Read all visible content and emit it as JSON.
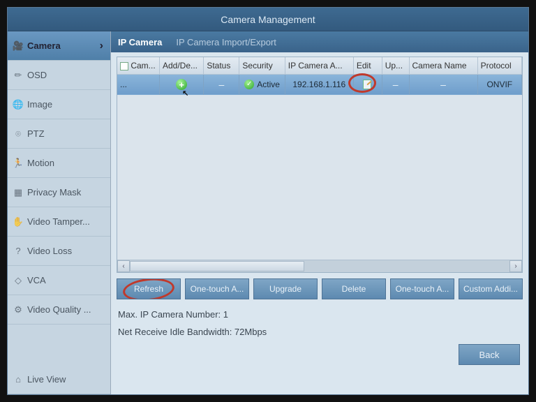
{
  "title": "Camera Management",
  "sidebar": {
    "items": [
      {
        "label": "Camera"
      },
      {
        "label": "OSD"
      },
      {
        "label": "Image"
      },
      {
        "label": "PTZ"
      },
      {
        "label": "Motion"
      },
      {
        "label": "Privacy Mask"
      },
      {
        "label": "Video Tamper..."
      },
      {
        "label": "Video Loss"
      },
      {
        "label": "VCA"
      },
      {
        "label": "Video Quality ..."
      }
    ],
    "footer": {
      "label": "Live View"
    }
  },
  "tabs": [
    {
      "label": "IP Camera"
    },
    {
      "label": "IP Camera Import/Export"
    }
  ],
  "table": {
    "columns": [
      "Cam...",
      "Add/De...",
      "Status",
      "Security",
      "IP Camera A...",
      "Edit",
      "Up...",
      "Camera Name",
      "Protocol"
    ],
    "rows": [
      {
        "cam": "...",
        "add": "+",
        "status": "–",
        "security": "Active",
        "ip": "192.168.1.116",
        "edit": "edit",
        "up": "–",
        "name": "–",
        "protocol": "ONVIF"
      }
    ]
  },
  "buttons": {
    "refresh": "Refresh",
    "onetouch1": "One-touch A...",
    "upgrade": "Upgrade",
    "delete": "Delete",
    "onetouch2": "One-touch A...",
    "custom": "Custom Addi..."
  },
  "info": {
    "max": "Max. IP Camera Number: 1",
    "bandwidth": "Net Receive Idle Bandwidth: 72Mbps"
  },
  "back": "Back",
  "icons": {
    "camera": "🎥",
    "osd": "✏",
    "image": "🌐",
    "ptz": "⌾",
    "motion": "🏃",
    "privacy": "▦",
    "tamper": "✋",
    "loss": "?",
    "vca": "◇",
    "quality": "⚙",
    "live": "⌂"
  }
}
